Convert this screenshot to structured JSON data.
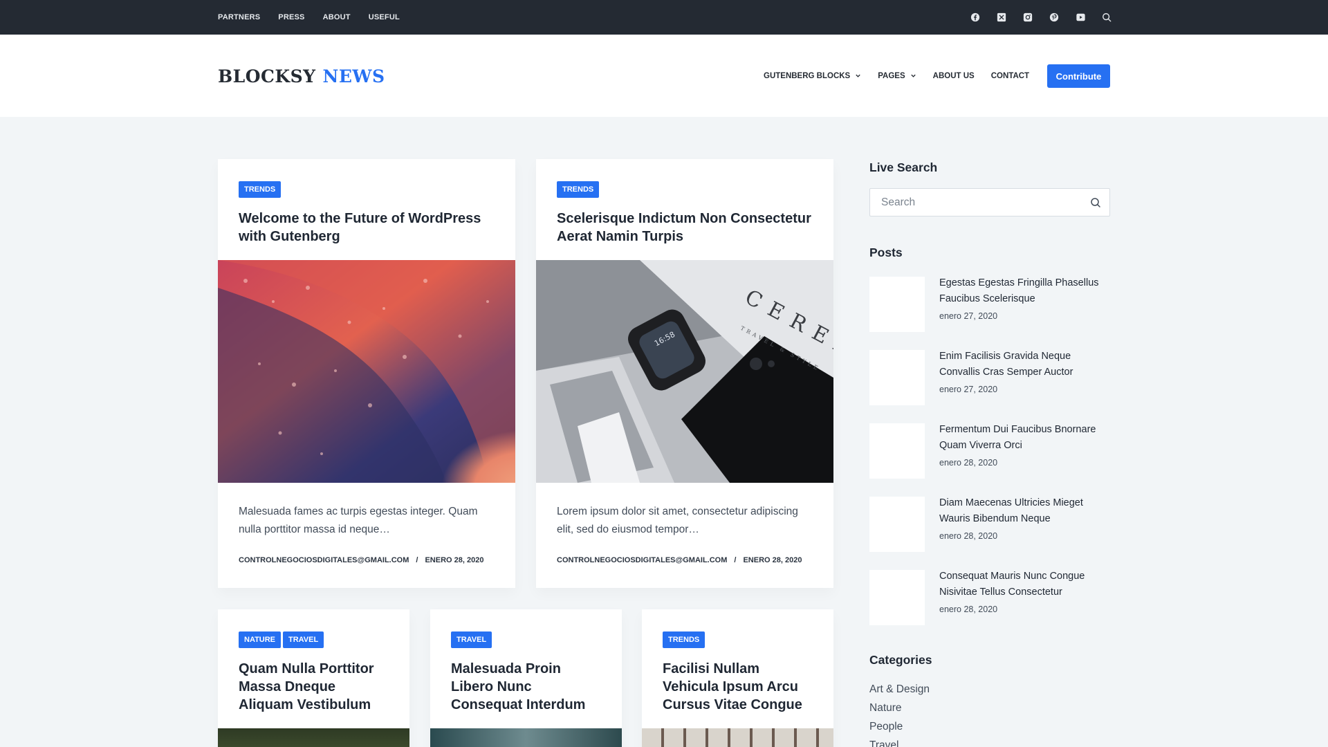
{
  "topbar": {
    "links": [
      "PARTNERS",
      "PRESS",
      "ABOUT",
      "USEFUL"
    ],
    "social_icons": [
      "facebook-icon",
      "x-twitter-icon",
      "instagram-icon",
      "pinterest-icon",
      "youtube-icon",
      "search-icon"
    ]
  },
  "header": {
    "logo_part1": "BLOCKSY",
    "logo_part2": "NEWS",
    "nav": [
      {
        "label": "GUTENBERG BLOCKS",
        "dropdown": true
      },
      {
        "label": "PAGES",
        "dropdown": true
      },
      {
        "label": "ABOUT US",
        "dropdown": false
      },
      {
        "label": "CONTACT",
        "dropdown": false
      }
    ],
    "cta": "Contribute"
  },
  "posts": [
    {
      "tags": [
        "TRENDS"
      ],
      "title": "Welcome to the Future of WordPress with Gutenberg",
      "excerpt": "Malesuada fames ac turpis egestas integer. Quam nulla porttitor massa id neque…",
      "author": "CONTROLNEGOCIOSDIGITALES@GMAIL.COM",
      "date": "ENERO 28, 2020"
    },
    {
      "tags": [
        "TRENDS"
      ],
      "title": "Scelerisque Indictum Non Consectetur Aerat Namin Turpis",
      "excerpt": "Lorem ipsum dolor sit amet, consectetur adipiscing elit, sed do eiusmod tempor…",
      "author": "CONTROLNEGOCIOSDIGITALES@GMAIL.COM",
      "date": "ENERO 28, 2020"
    },
    {
      "tags": [
        "NATURE",
        "TRAVEL"
      ],
      "title": "Quam Nulla Porttitor Massa Dneque Aliquam Vestibulum"
    },
    {
      "tags": [
        "TRAVEL"
      ],
      "title": "Malesuada Proin Libero Nunc Consequat Interdum"
    },
    {
      "tags": [
        "TRENDS"
      ],
      "title": "Facilisi Nullam Vehicula Ipsum Arcu Cursus Vitae Congue"
    }
  ],
  "image_text": {
    "poster_word": "CEREA",
    "poster_sub": "TRAVEL & STYLE",
    "watch_time": "16:58"
  },
  "sidebar": {
    "live_search_title": "Live Search",
    "search_placeholder": "Search",
    "posts_title": "Posts",
    "recent_posts": [
      {
        "title": "Egestas Egestas Fringilla Phasellus Faucibus Scelerisque",
        "date": "enero 27, 2020"
      },
      {
        "title": "Enim Facilisis Gravida Neque Convallis Cras Semper Auctor",
        "date": "enero 27, 2020"
      },
      {
        "title": "Fermentum Dui Faucibus Bnornare Quam Viverra Orci",
        "date": "enero 28, 2020"
      },
      {
        "title": "Diam Maecenas Ultricies Mieget Wauris Bibendum Neque",
        "date": "enero 28, 2020"
      },
      {
        "title": "Consequat Mauris Nunc Congue Nisivitae Tellus Consectetur",
        "date": "enero 28, 2020"
      }
    ],
    "categories_title": "Categories",
    "categories": [
      "Art & Design",
      "Nature",
      "People",
      "Travel"
    ]
  },
  "colors": {
    "accent": "#2670f2",
    "topbar_bg": "#242a33",
    "page_bg": "#f2f5f7"
  }
}
